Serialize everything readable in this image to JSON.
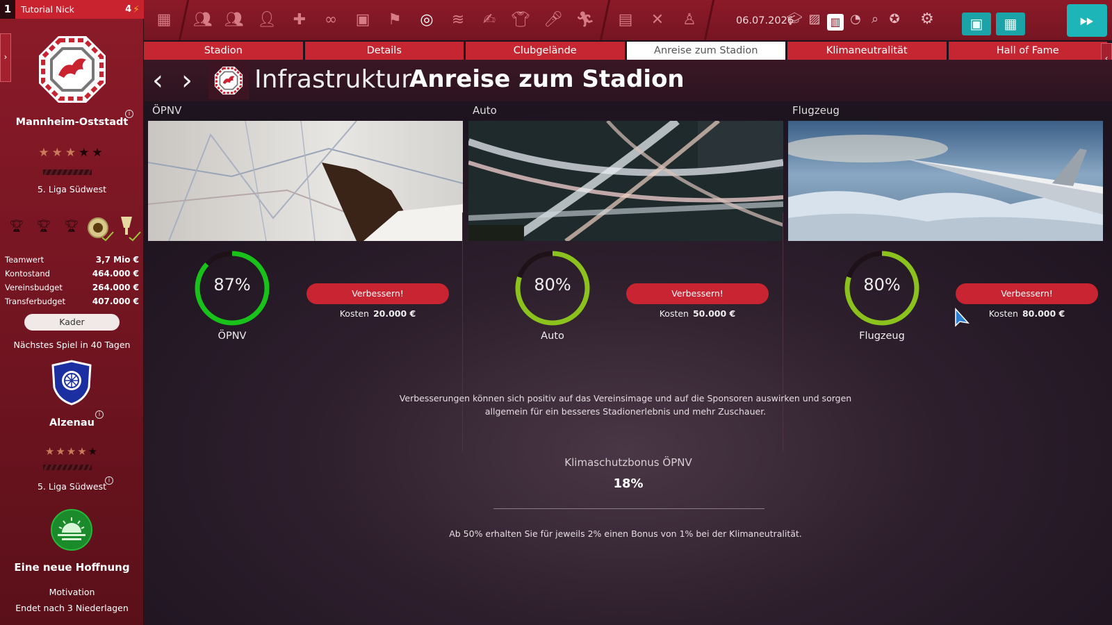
{
  "player": {
    "number": "1",
    "name": "Tutorial Nick",
    "count": "4"
  },
  "club": {
    "name": "Mannheim-Oststadt",
    "rating": {
      "filled": 3,
      "total": 5
    },
    "league": "5. Liga Südwest",
    "stats": [
      {
        "label": "Teamwert",
        "value": "3,7 Mio €"
      },
      {
        "label": "Kontostand",
        "value": "464.000 €"
      },
      {
        "label": "Vereinsbudget",
        "value": "264.000 €"
      },
      {
        "label": "Transferbudget",
        "value": "407.000 €"
      }
    ],
    "squad_button": "Kader"
  },
  "next_match": {
    "text": "Nächstes Spiel in 40 Tagen",
    "opponent": "Alzenau",
    "rating": {
      "filled": 4,
      "total": 5
    },
    "league": "5. Liga Südwest"
  },
  "motivation": {
    "title": "Eine neue Hoffnung",
    "label": "Motivation",
    "note": "Endet nach 3 Niederlagen"
  },
  "topbar": {
    "date": "06.07.2026"
  },
  "tabs": [
    {
      "label": "Stadion"
    },
    {
      "label": "Details"
    },
    {
      "label": "Clubgelände"
    },
    {
      "label": "Anreise zum Stadion"
    },
    {
      "label": "Klimaneutralität"
    },
    {
      "label": "Hall of Fame"
    }
  ],
  "header": {
    "title": "Infrastruktur",
    "subtitle": "Anreise zum Stadion"
  },
  "cards": [
    {
      "label": "ÖPNV",
      "percent_text": "87%",
      "percent": 87,
      "gauge_label": "ÖPNV",
      "button": "Verbessern!",
      "cost_label": "Kosten",
      "cost_value": "20.000 €",
      "color": "#18c21a"
    },
    {
      "label": "Auto",
      "percent_text": "80%",
      "percent": 80,
      "gauge_label": "Auto",
      "button": "Verbessern!",
      "cost_label": "Kosten",
      "cost_value": "50.000 €",
      "color": "#8cc21e"
    },
    {
      "label": "Flugzeug",
      "percent_text": "80%",
      "percent": 80,
      "gauge_label": "Flugzeug",
      "button": "Verbessern!",
      "cost_label": "Kosten",
      "cost_value": "80.000 €",
      "color": "#8cc21e"
    }
  ],
  "info": {
    "text": "Verbesserungen können sich positiv auf das Vereinsimage und auf die Sponsoren auswirken und sorgen allgemein für ein besseres Stadionerlebnis und mehr Zuschauer.",
    "bonus_title": "Klimaschutzbonus ÖPNV",
    "bonus_value": "18%",
    "bonus_note": "Ab 50% erhalten Sie für jeweils 2% einen Bonus von 1% bei der Klimaneutralität."
  },
  "colors": {
    "primary": "#c62632",
    "accent": "#1eb5b8",
    "gauge_high": "#18c21a",
    "gauge_mid": "#8cc21e"
  }
}
